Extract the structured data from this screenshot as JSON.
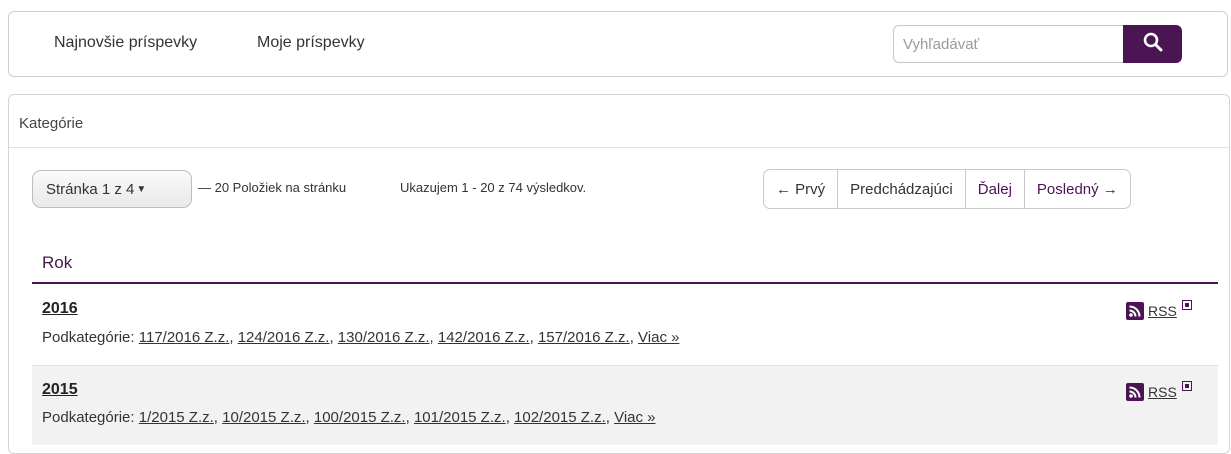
{
  "nav": {
    "items": [
      "Najnovšie príspevky",
      "Moje príspevky"
    ]
  },
  "search": {
    "placeholder": "Vyhľadávať"
  },
  "panel": {
    "title": "Kategórie"
  },
  "pagination": {
    "page_dropdown": "Stránka 1 z 4",
    "per_page": "— 20 Položiek na stránku",
    "showing": "Ukazujem 1 - 20 z 74 výsledkov.",
    "buttons": [
      "← Prvý",
      "Predchádzajúci",
      "Ďalej",
      "Posledný →"
    ]
  },
  "section": {
    "title": "Rok"
  },
  "rows": [
    {
      "year": "2016",
      "sub_label": "Podkategórie:",
      "links": [
        "117/2016 Z.z.",
        "124/2016 Z.z.",
        "130/2016 Z.z.",
        "142/2016 Z.z.",
        "157/2016 Z.z."
      ],
      "more": "Viac »",
      "rss": "RSS"
    },
    {
      "year": "2015",
      "sub_label": "Podkategórie:",
      "links": [
        "1/2015 Z.z.",
        "10/2015 Z.z.",
        "100/2015 Z.z.",
        "101/2015 Z.z.",
        "102/2015 Z.z."
      ],
      "more": "Viac »",
      "rss": "RSS"
    }
  ],
  "colors": {
    "accent": "#4a1552"
  },
  "icons": {
    "search": "search-icon",
    "rss": "rss-icon",
    "external": "external-link-icon"
  }
}
